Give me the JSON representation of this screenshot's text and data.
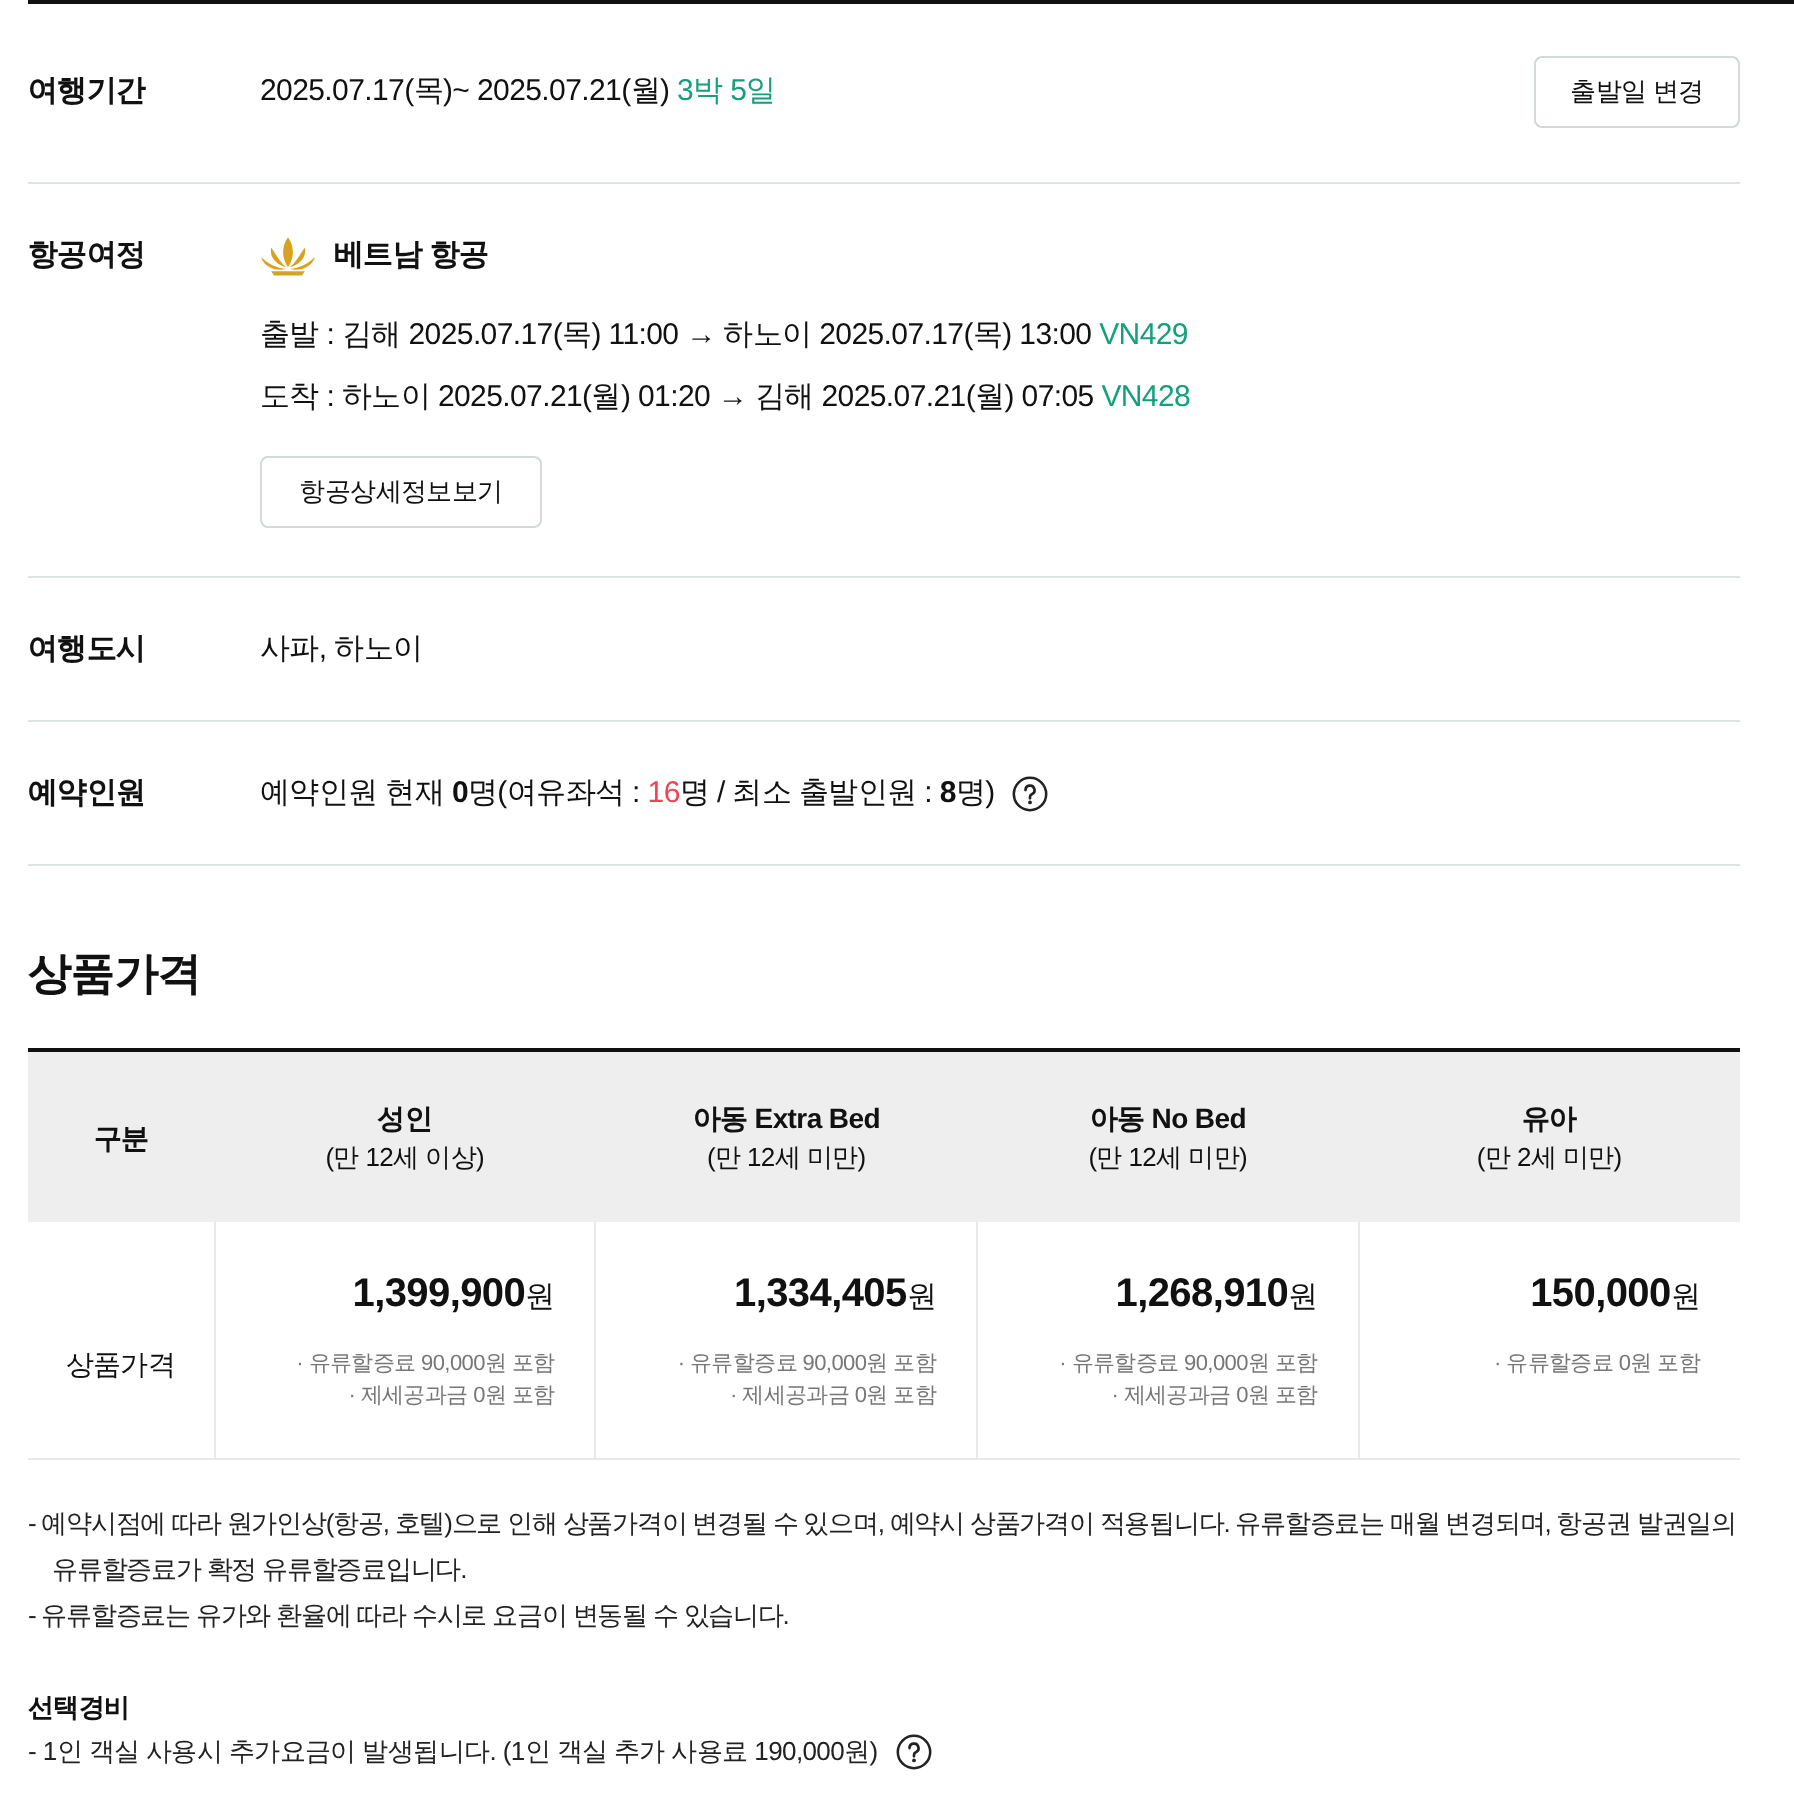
{
  "info_rows": [
    {
      "kind": "period",
      "label": "여행기간",
      "dates": "2025.07.17(목)~ 2025.07.21(월)",
      "duration": "3박 5일",
      "button": "출발일 변경"
    },
    {
      "kind": "flight",
      "label": "항공여정",
      "airline": "베트남 항공",
      "legs": [
        {
          "route": "출발 : 김해 2025.07.17(목) 11:00 → 하노이 2025.07.17(목) 13:00",
          "flight_no": "VN429"
        },
        {
          "route": "도착 : 하노이 2025.07.21(월) 01:20 → 김해 2025.07.21(월) 07:05",
          "flight_no": "VN428"
        }
      ],
      "button": "항공상세정보보기"
    },
    {
      "kind": "text",
      "label": "여행도시",
      "value": "사파, 하노이"
    },
    {
      "kind": "travelers",
      "label": "예약인원",
      "before": "예약인원 현재 **0**명(여유좌석 : ",
      "seats_left": "16",
      "after": "명 / 최소 출발인원 : **8**명)",
      "help": true
    }
  ],
  "price_section": {
    "title": "상품가격",
    "table": {
      "columns": [
        {
          "title": "구분"
        },
        {
          "title": "성인",
          "subtitle": "(만 12세 이상)"
        },
        {
          "title": "아동 Extra Bed",
          "subtitle": "(만 12세 미만)"
        },
        {
          "title": "아동 No Bed",
          "subtitle": "(만 12세 미만)"
        },
        {
          "title": "유아",
          "subtitle": "(만 2세 미만)"
        }
      ],
      "rows": [
        {
          "cells": [
            {
              "kind": "label",
              "text": "상품가격"
            },
            {
              "kind": "price",
              "amount": "1,399,900",
              "unit": "원",
              "notes": [
                "· 유류할증료 90,000원 포함",
                "· 제세공과금 0원 포함"
              ]
            },
            {
              "kind": "price",
              "amount": "1,334,405",
              "unit": "원",
              "notes": [
                "· 유류할증료 90,000원 포함",
                "· 제세공과금 0원 포함"
              ]
            },
            {
              "kind": "price",
              "amount": "1,268,910",
              "unit": "원",
              "notes": [
                "· 유류할증료 90,000원 포함",
                "· 제세공과금 0원 포함"
              ]
            },
            {
              "kind": "price",
              "amount": "150,000",
              "unit": "원",
              "notes": [
                "· 유류할증료 0원 포함"
              ]
            }
          ]
        }
      ]
    },
    "notes": [
      "- 예약시점에 따라 원가인상(항공, 호텔)으로 인해 상품가격이 변경될 수 있으며, 예약시 상품가격이 적용됩니다. 유류할증료는 매월 변경되며, 항공권 발권일의 유류할증료가 확정 유류할증료입니다.",
      "- 유류할증료는 유가와 환율에 따라 수시로 요금이 변동될 수 있습니다."
    ]
  },
  "optional_costs": {
    "title": "선택경비",
    "items": [
      {
        "text": "- 1인 객실 사용시 추가요금이 발생됩니다. (1인 객실 추가 사용료 190,000원)",
        "help": true
      }
    ]
  }
}
